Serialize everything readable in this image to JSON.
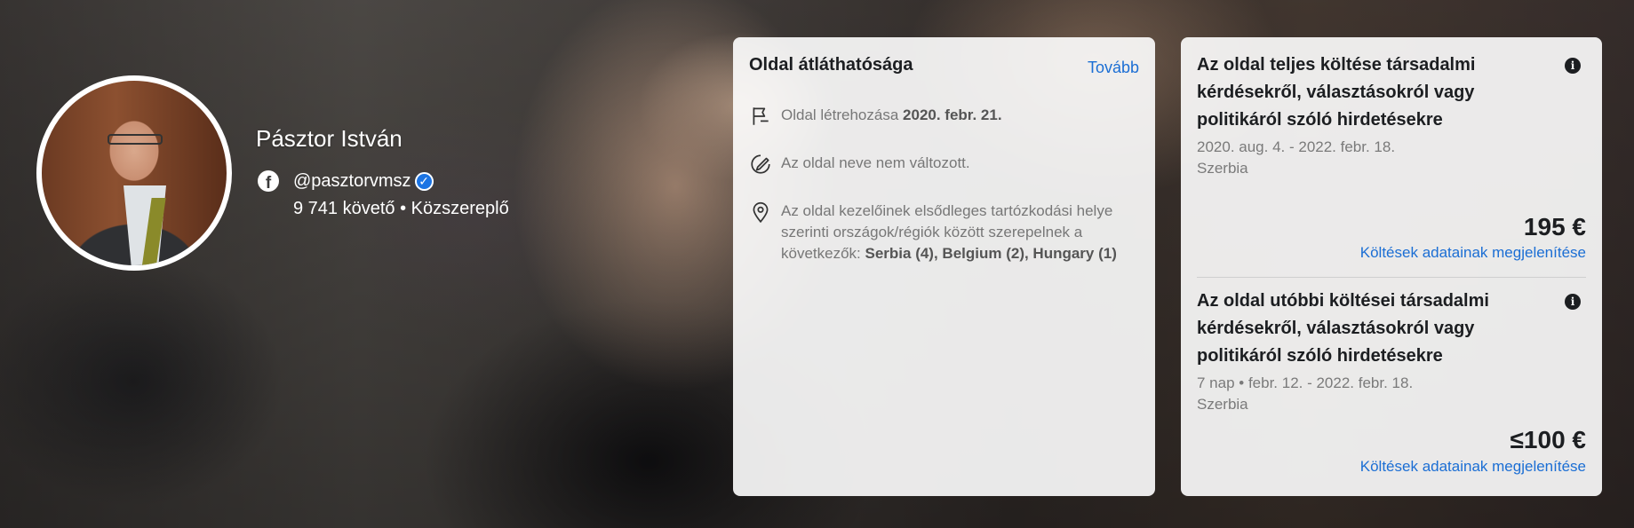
{
  "profile": {
    "name": "Pásztor István",
    "handle": "@pasztorvmsz",
    "followers_line": "9 741 követő • Közszereplő",
    "verified_icon": "verified-checkmark-icon",
    "network_icon": "facebook-icon"
  },
  "transparency": {
    "title": "Oldal átláthatósága",
    "more_link": "Tovább",
    "created_label": "Oldal létrehozása ",
    "created_date": "2020. febr. 21.",
    "name_unchanged": "Az oldal neve nem változott.",
    "locations_text": "Az oldal kezelőinek elsődleges tartózkodási helye szerinti országok/régiók között szerepelnek a következők: ",
    "locations_list": "Serbia (4), Belgium (2), Hungary (1)",
    "icons": [
      "flag-icon",
      "edit-name-icon",
      "location-pin-icon"
    ]
  },
  "spend": {
    "total": {
      "title": "Az oldal teljes költése társadalmi kérdésekről, választásokról vagy politikáról szóló hirdetésekre",
      "period": "2020. aug. 4. - 2022. febr. 18.",
      "region": "Szerbia",
      "amount": "195 €",
      "details_link": "Költések adatainak megjelenítése"
    },
    "recent": {
      "title": "Az oldal utóbbi költései társadalmi kérdésekről, választásokról vagy politikáról szóló hirdetésekre",
      "period": "7 nap • febr. 12. - 2022. febr. 18.",
      "region": "Szerbia",
      "amount": "≤100 €",
      "details_link": "Költések adatainak megjelenítése"
    }
  },
  "colors": {
    "link": "#1b6ed4",
    "verified": "#1b74e4"
  }
}
